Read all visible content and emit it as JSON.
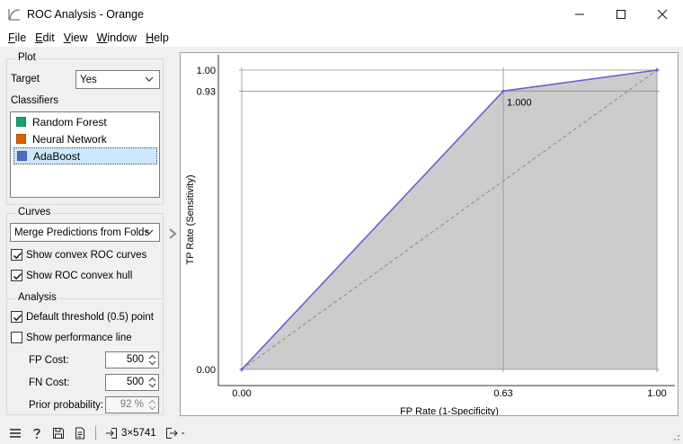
{
  "window": {
    "title": "ROC Analysis - Orange"
  },
  "menu": [
    {
      "label": "File",
      "u": "F",
      "rest": "ile"
    },
    {
      "label": "Edit",
      "u": "E",
      "rest": "dit"
    },
    {
      "label": "View",
      "u": "V",
      "rest": "iew"
    },
    {
      "label": "Window",
      "u": "W",
      "rest": "indow"
    },
    {
      "label": "Help",
      "u": "H",
      "rest": "elp"
    }
  ],
  "plot_box": {
    "title": "Plot",
    "target_label": "Target",
    "target_value": "Yes",
    "classifiers_label": "Classifiers",
    "classifiers": [
      {
        "name": "Random Forest",
        "color": "#1b9e77",
        "selected": false
      },
      {
        "name": "Neural Network",
        "color": "#d95f02",
        "selected": false
      },
      {
        "name": "AdaBoost",
        "color": "#4a6fc1",
        "selected": true
      }
    ]
  },
  "curves_box": {
    "title": "Curves",
    "method": "Merge Predictions from Folds",
    "show_convex_curves": {
      "label": "Show convex ROC curves",
      "checked": true
    },
    "show_convex_hull": {
      "label": "Show ROC convex hull",
      "checked": true
    }
  },
  "analysis_box": {
    "title": "Analysis",
    "default_threshold": {
      "label": "Default threshold (0.5) point",
      "checked": true
    },
    "performance_line": {
      "label": "Show performance line",
      "checked": false
    },
    "fp_cost_label": "FP Cost:",
    "fp_cost": "500",
    "fn_cost_label": "FN Cost:",
    "fn_cost": "500",
    "prior_label": "Prior probability:",
    "prior": "92 %"
  },
  "status": {
    "data_shape": "3×5741",
    "output": "-"
  },
  "colors": {
    "curve": "#6b5fd3",
    "hull_fill": "#cccccc",
    "selection": "#cce8ff"
  },
  "chart_data": {
    "type": "line",
    "xlabel": "FP Rate (1-Specificity)",
    "ylabel": "TP Rate (Sensitivity)",
    "xlim": [
      0,
      1
    ],
    "ylim": [
      0,
      1
    ],
    "x_ticks": [
      "0.00",
      "0.63",
      "1.00"
    ],
    "x_tick_values": [
      0,
      0.63,
      1
    ],
    "y_ticks": [
      "0.00",
      "0.93",
      "1.00"
    ],
    "y_tick_values": [
      0,
      0.93,
      1
    ],
    "series": [
      {
        "name": "AdaBoost",
        "x": [
          0,
          0.63,
          1
        ],
        "y": [
          0,
          0.93,
          1
        ]
      }
    ],
    "diagonal": {
      "x": [
        0,
        1
      ],
      "y": [
        0,
        1
      ]
    },
    "annotations": [
      {
        "text": "1.000",
        "x": 0.63,
        "y": 0.93
      }
    ]
  }
}
